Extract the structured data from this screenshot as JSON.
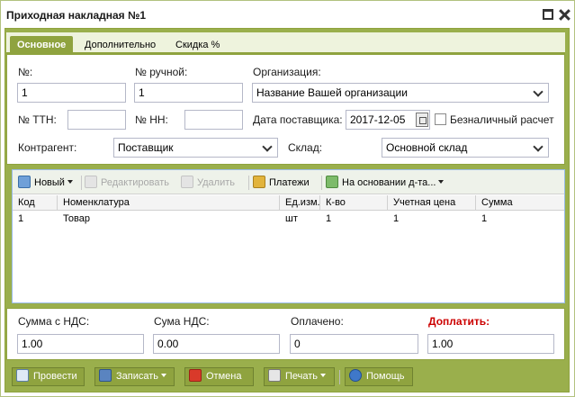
{
  "window": {
    "title": "Приходная накладная №1"
  },
  "tabs": [
    {
      "label": "Основное"
    },
    {
      "label": "Дополнительно"
    },
    {
      "label": "Скидка %"
    }
  ],
  "form": {
    "number_label": "№:",
    "number_value": "1",
    "manual_number_label": "№ ручной:",
    "manual_number_value": "1",
    "organization_label": "Организация:",
    "organization_value": "Название Вашей организации",
    "ttn_label": "№ ТТН:",
    "ttn_value": "",
    "nn_label": "№ НН:",
    "nn_value": "",
    "supplier_date_label": "Дата поставщика:",
    "supplier_date_value": "2017-12-05",
    "cashless_label": "Безналичный расчет",
    "counterparty_label": "Контрагент:",
    "counterparty_value": "Поставщик",
    "warehouse_label": "Склад:",
    "warehouse_value": "Основной склад"
  },
  "grid_toolbar": {
    "new_label": "Новый",
    "edit_label": "Редактировать",
    "delete_label": "Удалить",
    "payments_label": "Платежи",
    "based_on_label": "На основании д-та..."
  },
  "grid": {
    "columns": [
      "Код",
      "Номенклатура",
      "Ед.изм.",
      "К-во",
      "Учетная цена",
      "Сумма"
    ],
    "rows": [
      [
        "1",
        "Товар",
        "шт",
        "1",
        "1",
        "1"
      ]
    ]
  },
  "totals": {
    "sum_vat_label": "Сумма с НДС:",
    "sum_vat_value": "1.00",
    "vat_label": "Сума НДС:",
    "vat_value": "0.00",
    "paid_label": "Оплачено:",
    "paid_value": "0",
    "to_pay_label": "Доплатить:",
    "to_pay_value": "1.00"
  },
  "actions": {
    "post_label": "Провести",
    "save_label": "Записать",
    "cancel_label": "Отмена",
    "print_label": "Печать",
    "help_label": "Помощь"
  }
}
